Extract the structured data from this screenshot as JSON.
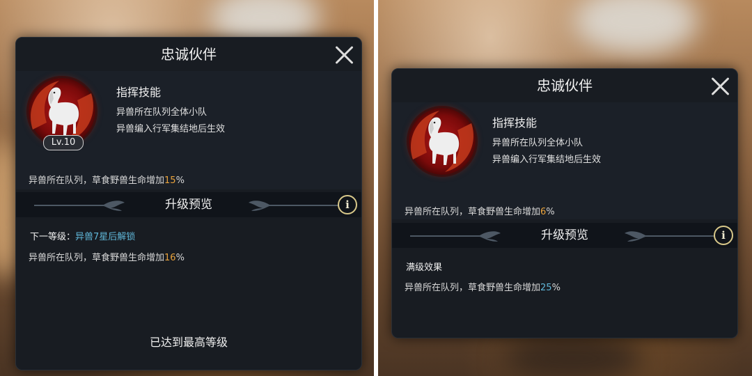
{
  "left": {
    "title": "忠诚伙伴",
    "level_badge": "Lv.10",
    "skill": {
      "name": "指挥技能",
      "line1": "异兽所在队列全体小队",
      "line2": "异兽编入行军集结地后生效"
    },
    "current_effect": {
      "text": "异兽所在队列，草食野兽生命增加",
      "value": "15",
      "unit": "%"
    },
    "preview_label": "升级预览",
    "next_level": {
      "label": "下一等级：",
      "condition": "异兽7星后解锁"
    },
    "next_effect": {
      "text": "异兽所在队列，草食野兽生命增加",
      "value": "16",
      "unit": "%"
    },
    "max_level_text": "已达到最高等级"
  },
  "right": {
    "title": "忠诚伙伴",
    "skill": {
      "name": "指挥技能",
      "line1": "异兽所在队列全体小队",
      "line2": "异兽编入行军集结地后生效"
    },
    "current_effect": {
      "text": "异兽所在队列，草食野兽生命增加",
      "value": "6",
      "unit": "%"
    },
    "preview_label": "升级预览",
    "max_effect_label": "满级效果",
    "max_effect": {
      "text": "异兽所在队列，草食野兽生命增加",
      "value": "25",
      "unit": "%"
    }
  },
  "icons": [
    "close-icon",
    "info-icon",
    "horse-icon",
    "wing-ornament-icon"
  ],
  "colors": {
    "dialog_bg": "#181c22",
    "highlight_orange": "#e9a23b",
    "highlight_blue": "#5fb6d8",
    "info_ring": "#d9c98a"
  }
}
